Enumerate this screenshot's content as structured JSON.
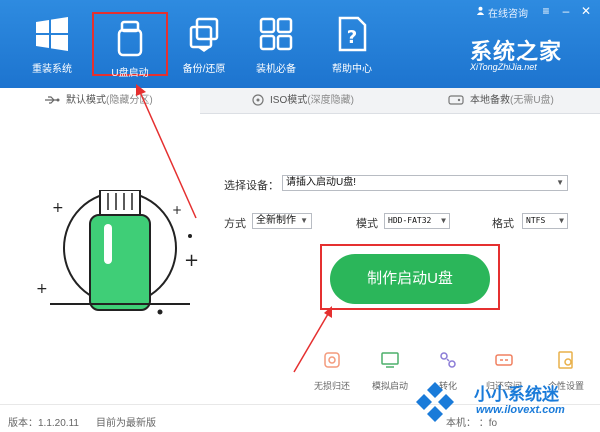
{
  "header": {
    "nav": [
      {
        "label": "重装系统",
        "icon": "windows-logo-icon"
      },
      {
        "label": "U盘启动",
        "icon": "usb-drive-icon"
      },
      {
        "label": "备份/还原",
        "icon": "backup-restore-icon"
      },
      {
        "label": "装机必备",
        "icon": "apps-grid-icon"
      },
      {
        "label": "帮助中心",
        "icon": "help-document-icon"
      }
    ],
    "online_help": "在线咨询",
    "brand_title": "系统之家",
    "brand_sub": "XiTongZhiJia.net"
  },
  "tabs": [
    {
      "label": "默认模式",
      "suffix": "(隐藏分区)",
      "icon": "usb-symbol-icon"
    },
    {
      "label": "ISO模式",
      "suffix": "(深度隐藏)",
      "icon": "disc-icon"
    },
    {
      "label": "本地备救",
      "suffix": "(无需U盘)",
      "icon": "hard-drive-icon"
    }
  ],
  "form": {
    "device_label": "选择设备：",
    "device_value": "请插入启动U盘!",
    "method_label": "方式",
    "method_value": "全新制作",
    "mode_label": "模式",
    "mode_value": "HDD-FAT32",
    "format_label": "格式",
    "format_value": "NTFS"
  },
  "make_button": "制作启动U盘",
  "tools": [
    {
      "label": "无损归还",
      "icon": "restore-icon"
    },
    {
      "label": "模拟启动",
      "icon": "simulate-boot-icon"
    },
    {
      "label": "转化",
      "icon": "convert-icon"
    },
    {
      "label": "归还空间",
      "icon": "reclaim-space-icon"
    },
    {
      "label": "个性设置",
      "icon": "personalize-icon"
    }
  ],
  "footer": {
    "version": "版本：1.1.20.11",
    "status": "目前为最新版",
    "right_text": "本机：    ：fo"
  },
  "watermark": {
    "title": "小小系统迷",
    "url": "www.ilovext.com"
  },
  "colors": {
    "header_blue": "#1d74cf",
    "accent_green": "#2bb65a",
    "annotation_red": "#e53030"
  }
}
